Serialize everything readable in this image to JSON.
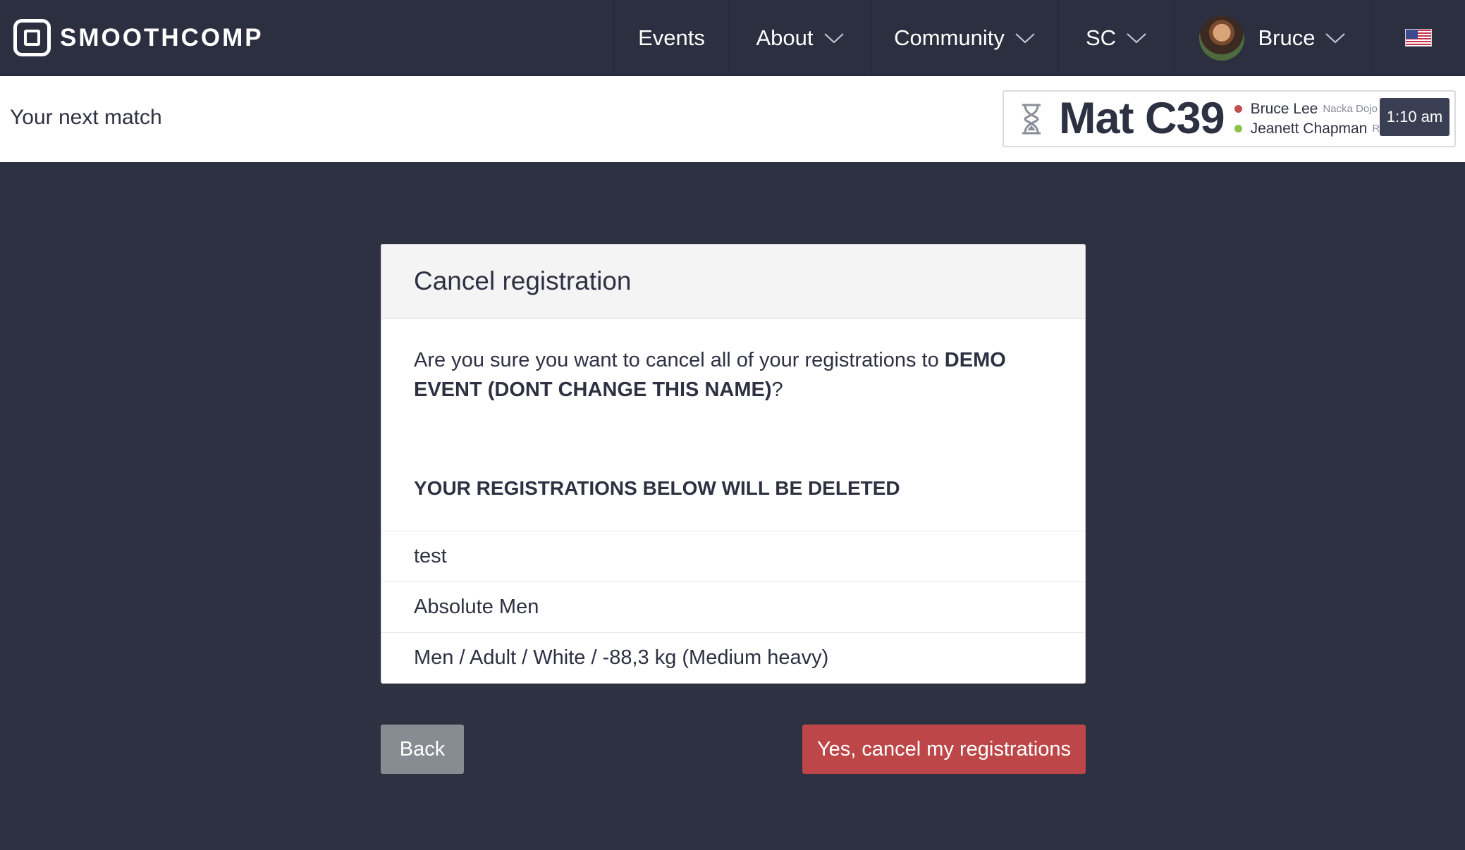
{
  "brand": {
    "name": "SMOOTHCOMP",
    "logo_icon": "smoothcomp-logo-icon"
  },
  "nav": {
    "events": "Events",
    "about": "About",
    "community": "Community",
    "sc": "SC",
    "user": "Bruce",
    "language_icon": "us-flag-icon"
  },
  "next_match": {
    "label": "Your next match",
    "mat": "Mat C39",
    "competitors": [
      {
        "name": "Bruce Lee",
        "club": "Nacka Dojo IF",
        "color": "#c0504d"
      },
      {
        "name": "Jeanett Chapman",
        "club": "Ri…",
        "color": "#8bc34a"
      }
    ],
    "time": "1:10 am"
  },
  "dialog": {
    "title": "Cancel registration",
    "question_prefix": "Are you sure you want to cancel all of your registrations to ",
    "event_name": "DEMO EVENT (DONT CHANGE THIS NAME)",
    "question_suffix": "?",
    "deleted_heading": "YOUR REGISTRATIONS BELOW WILL BE DELETED",
    "registrations": [
      "test",
      "Absolute Men",
      "Men / Adult / White / -88,3 kg (Medium heavy)"
    ]
  },
  "actions": {
    "back": "Back",
    "confirm": "Yes, cancel my registrations"
  },
  "colors": {
    "background": "#2e3142",
    "nav_background": "#2b2f40",
    "danger": "#bd4748",
    "secondary": "#878c92"
  }
}
